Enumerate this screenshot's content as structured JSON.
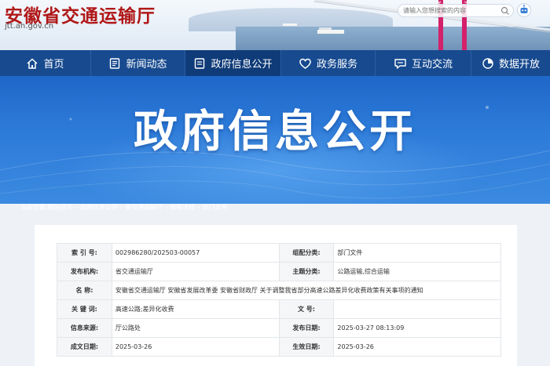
{
  "header": {
    "site_title": "安徽省交通运输厅",
    "site_url": "jtt.ah.gov.cn",
    "search_placeholder": "请输入您想搜索的内容"
  },
  "nav": {
    "items": [
      {
        "label": "首页",
        "icon": "home-icon"
      },
      {
        "label": "新闻动态",
        "icon": "news-icon"
      },
      {
        "label": "政府信息公开",
        "icon": "document-icon",
        "active": true
      },
      {
        "label": "政务服务",
        "icon": "heart-icon"
      },
      {
        "label": "互动交流",
        "icon": "chat-icon"
      },
      {
        "label": "数据开放",
        "icon": "chart-icon"
      }
    ]
  },
  "banner": {
    "title": "政府信息公开"
  },
  "breadcrumb": [
    "当前位置:",
    "网站首页",
    "政府信息公开",
    "省交通运输厅",
    "政策法规",
    "部门文件"
  ],
  "info": {
    "rows": [
      {
        "l1": "索 引 号:",
        "v1": "002986280/202503-00057",
        "l2": "组配分类:",
        "v2": "部门文件"
      },
      {
        "l1": "发布机构:",
        "v1": "省交通运输厅",
        "l2": "主题分类:",
        "v2": "公路运输,综合运输"
      },
      {
        "l1": "名 称:",
        "full": "安徽省交通运输厅 安徽省发展改革委 安徽省财政厅 关于调整我省部分高速公路差异化收费政策有关事项的通知"
      },
      {
        "l1": "关 键 词:",
        "v1": "高速公路;差异化收费",
        "l2": "文 号:",
        "v2": ""
      },
      {
        "l1": "信息来源:",
        "v1": "厅公路处",
        "l2": "发布日期:",
        "v2": "2025-03-27 08:13:09"
      },
      {
        "l1": "成文日期:",
        "v1": "2025-03-26",
        "l2": "生效日期:",
        "v2": "2025-03-26"
      }
    ]
  },
  "colors": {
    "brand_red": "#b01818",
    "nav_blue": "#174a8f",
    "banner_blue": "#2c7ad8"
  }
}
